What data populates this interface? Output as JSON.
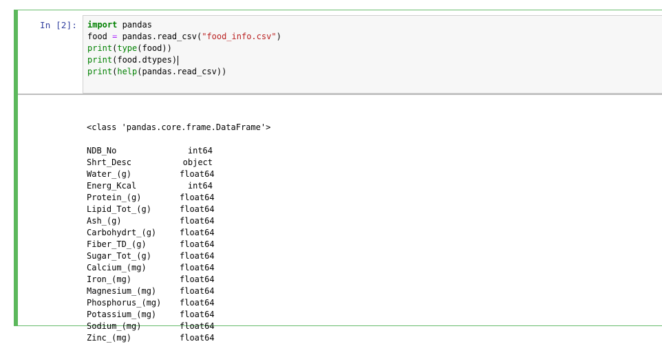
{
  "cell": {
    "prompt": "In  [2]:",
    "code_lines": [
      {
        "tokens": [
          {
            "t": "import",
            "c": "kw"
          },
          {
            "t": " pandas",
            "c": ""
          }
        ]
      },
      {
        "tokens": [
          {
            "t": "food ",
            "c": ""
          },
          {
            "t": "=",
            "c": "op"
          },
          {
            "t": " pandas.read_csv(",
            "c": ""
          },
          {
            "t": "\"food_info.csv\"",
            "c": "str"
          },
          {
            "t": ")",
            "c": ""
          }
        ]
      },
      {
        "tokens": [
          {
            "t": "print",
            "c": "bi"
          },
          {
            "t": "(",
            "c": ""
          },
          {
            "t": "type",
            "c": "bi"
          },
          {
            "t": "(food))",
            "c": ""
          }
        ]
      },
      {
        "tokens": [
          {
            "t": "print",
            "c": "bi"
          },
          {
            "t": "(food.dtypes)",
            "c": ""
          }
        ],
        "cursor": true
      },
      {
        "tokens": [
          {
            "t": "print",
            "c": "bi"
          },
          {
            "t": "(",
            "c": ""
          },
          {
            "t": "help",
            "c": "bi"
          },
          {
            "t": "(pandas.read_csv))",
            "c": ""
          }
        ]
      }
    ]
  },
  "output": {
    "class_line": "<class 'pandas.core.frame.DataFrame'>",
    "dtypes": [
      {
        "name": "NDB_No",
        "type": "int64"
      },
      {
        "name": "Shrt_Desc",
        "type": "object"
      },
      {
        "name": "Water_(g)",
        "type": "float64"
      },
      {
        "name": "Energ_Kcal",
        "type": "int64"
      },
      {
        "name": "Protein_(g)",
        "type": "float64"
      },
      {
        "name": "Lipid_Tot_(g)",
        "type": "float64"
      },
      {
        "name": "Ash_(g)",
        "type": "float64"
      },
      {
        "name": "Carbohydrt_(g)",
        "type": "float64"
      },
      {
        "name": "Fiber_TD_(g)",
        "type": "float64"
      },
      {
        "name": "Sugar_Tot_(g)",
        "type": "float64"
      },
      {
        "name": "Calcium_(mg)",
        "type": "float64"
      },
      {
        "name": "Iron_(mg)",
        "type": "float64"
      },
      {
        "name": "Magnesium_(mg)",
        "type": "float64"
      },
      {
        "name": "Phosphorus_(mg)",
        "type": "float64"
      },
      {
        "name": "Potassium_(mg)",
        "type": "float64"
      },
      {
        "name": "Sodium_(mg)",
        "type": "float64"
      },
      {
        "name": "Zinc_(mg)",
        "type": "float64"
      }
    ]
  },
  "colors": {
    "cell_border": "#66bb6a",
    "prompt": "#303f9f",
    "keyword": "#008000",
    "string": "#ba2121",
    "operator": "#aa22ff"
  }
}
